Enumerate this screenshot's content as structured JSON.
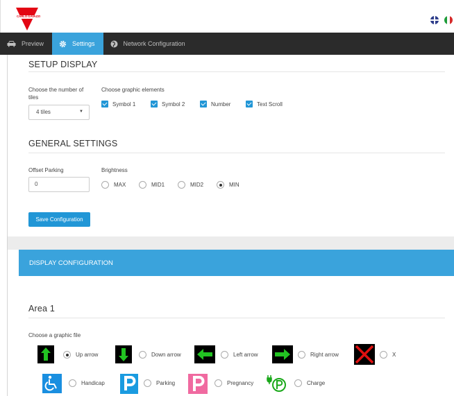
{
  "header": {
    "logo_text": "CARLO GAVAZZI"
  },
  "nav": {
    "items": [
      {
        "label": "Preview"
      },
      {
        "label": "Settings"
      },
      {
        "label": "Network Configuration"
      }
    ]
  },
  "setup_display": {
    "title": "SETUP DISPLAY",
    "tiles_label": "Choose the number of tiles",
    "tiles_value": "4 tiles",
    "elements_label": "Choose graphic elements",
    "elements": [
      "Symbol 1",
      "Symbol 2",
      "Number",
      "Text Scroll"
    ]
  },
  "general": {
    "title": "GENERAL SETTINGS",
    "offset_label": "Offset Parking",
    "offset_value": "0",
    "brightness_label": "Brightness",
    "brightness_options": [
      "MAX",
      "MID1",
      "MID2",
      "MIN"
    ],
    "brightness_selected": "MIN",
    "save_label": "Save Configuration"
  },
  "display_config": {
    "title": "DISPLAY CONFIGURATION",
    "area_title": "Area 1",
    "file_label": "Choose a graphic file",
    "row1": [
      "Up arrow",
      "Down arrow",
      "Left arrow",
      "Right arrow",
      "X"
    ],
    "row2": [
      "Handicap",
      "Parking",
      "Pregnancy",
      "Charge"
    ],
    "selected": "Up arrow"
  },
  "colors": {
    "accent": "#3aa3dc",
    "nav_bg": "#2b2b2b",
    "brand_red": "#e30613",
    "green_arrow": "#22c322"
  }
}
